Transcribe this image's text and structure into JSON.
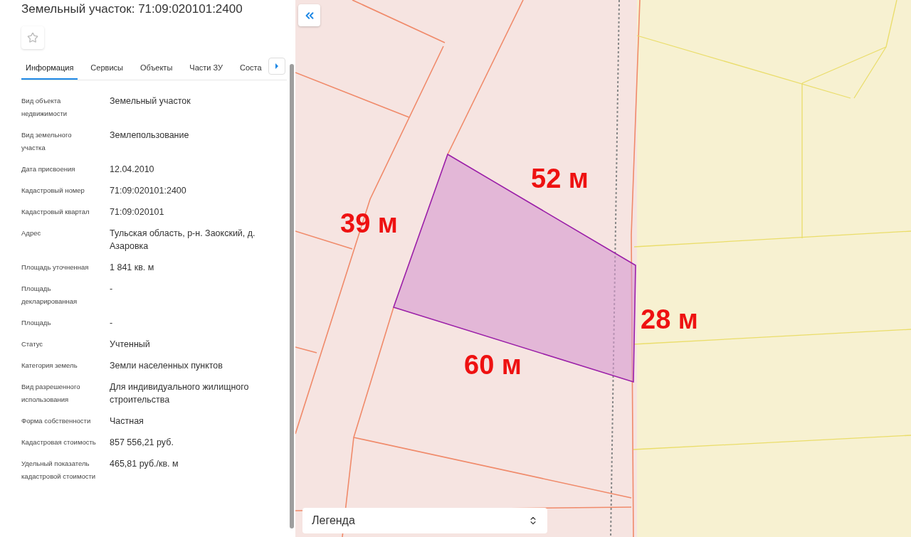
{
  "sidebar": {
    "title": "Земельный участок: 71:09:020101:2400",
    "tabs": [
      {
        "label": "Информация",
        "selected": true
      },
      {
        "label": "Сервисы",
        "selected": false
      },
      {
        "label": "Объекты",
        "selected": false
      },
      {
        "label": "Части ЗУ",
        "selected": false
      },
      {
        "label": "Соста",
        "selected": false
      }
    ],
    "fields": [
      {
        "label": "Вид объекта недвижимости",
        "value": "Земельный участок"
      },
      {
        "label": "Вид земельного участка",
        "value": "Землепользование"
      },
      {
        "label": "Дата присвоения",
        "value": "12.04.2010"
      },
      {
        "label": "Кадастровый номер",
        "value": "71:09:020101:2400"
      },
      {
        "label": "Кадастровый квартал",
        "value": "71:09:020101"
      },
      {
        "label": "Адрес",
        "value": "Тульская область, р-н. Заокский, д. Азаровка"
      },
      {
        "label": "Площадь уточненная",
        "value": "1 841 кв. м"
      },
      {
        "label": "Площадь декларированная",
        "value": "-"
      },
      {
        "label": "Площадь",
        "value": "-"
      },
      {
        "label": "Статус",
        "value": "Учтенный"
      },
      {
        "label": "Категория земель",
        "value": "Земли населенных пунктов"
      },
      {
        "label": "Вид разрешенного использования",
        "value": "Для индивидуального жилищного строительства"
      },
      {
        "label": "Форма собственности",
        "value": "Частная"
      },
      {
        "label": "Кадастровая стоимость",
        "value": "857 556,21 руб."
      },
      {
        "label": "Удельный показатель кадастровой стоимости",
        "value": "465,81 руб./кв. м"
      }
    ]
  },
  "map": {
    "measurements": [
      "52 м",
      "39 м",
      "28 м",
      "60 м"
    ],
    "legend": "Легенда"
  }
}
